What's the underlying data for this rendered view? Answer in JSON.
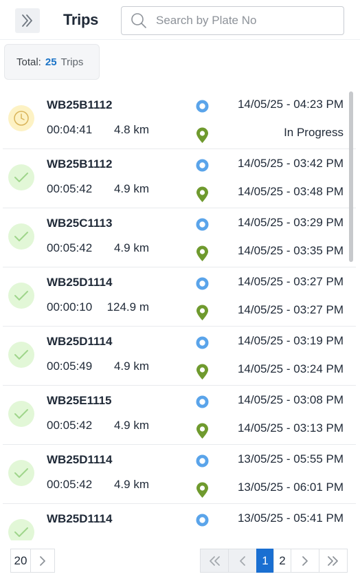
{
  "header": {
    "title": "Trips",
    "search_placeholder": "Search by Plate No"
  },
  "summary": {
    "total_label": "Total:",
    "total_count": "25",
    "total_unit": "Trips"
  },
  "trips": [
    {
      "plate": "WB25B1112",
      "duration": "00:04:41",
      "distance": "4.8 km",
      "start": "14/05/25 - 04:23 PM",
      "end": "In Progress",
      "status": "in-progress"
    },
    {
      "plate": "WB25B1112",
      "duration": "00:05:42",
      "distance": "4.9 km",
      "start": "14/05/25 - 03:42 PM",
      "end": "14/05/25 - 03:48 PM",
      "status": "completed"
    },
    {
      "plate": "WB25C1113",
      "duration": "00:05:42",
      "distance": "4.9 km",
      "start": "14/05/25 - 03:29 PM",
      "end": "14/05/25 - 03:35 PM",
      "status": "completed"
    },
    {
      "plate": "WB25D1114",
      "duration": "00:00:10",
      "distance": "124.9 m",
      "start": "14/05/25 - 03:27 PM",
      "end": "14/05/25 - 03:27 PM",
      "status": "completed"
    },
    {
      "plate": "WB25D1114",
      "duration": "00:05:49",
      "distance": "4.9 km",
      "start": "14/05/25 - 03:19 PM",
      "end": "14/05/25 - 03:24 PM",
      "status": "completed"
    },
    {
      "plate": "WB25E1115",
      "duration": "00:05:42",
      "distance": "4.9 km",
      "start": "14/05/25 - 03:08 PM",
      "end": "14/05/25 - 03:13 PM",
      "status": "completed"
    },
    {
      "plate": "WB25D1114",
      "duration": "00:05:42",
      "distance": "4.9 km",
      "start": "13/05/25 - 05:55 PM",
      "end": "13/05/25 - 06:01 PM",
      "status": "completed"
    },
    {
      "plate": "WB25D1114",
      "duration": "",
      "distance": "",
      "start": "13/05/25 - 05:41 PM",
      "end": "",
      "status": "completed"
    }
  ],
  "pagination": {
    "page_size": "20",
    "pages": [
      "1",
      "2"
    ],
    "current_page": "1"
  },
  "icons": {
    "expand": "double-chevron-right-icon",
    "search": "search-icon",
    "in_progress": "clock-icon",
    "completed": "check-icon",
    "start": "start-location-dot-icon",
    "end": "map-pin-icon"
  },
  "colors": {
    "accent": "#1a6fd1",
    "count": "#1a73c7",
    "start_dot": "#5aa4ea",
    "end_pin": "#6f9a2e",
    "progress_bg": "#fdf2c4",
    "progress_icon": "#d9b45a",
    "done_bg": "#e2f7d7",
    "done_icon": "#9fd58b"
  }
}
